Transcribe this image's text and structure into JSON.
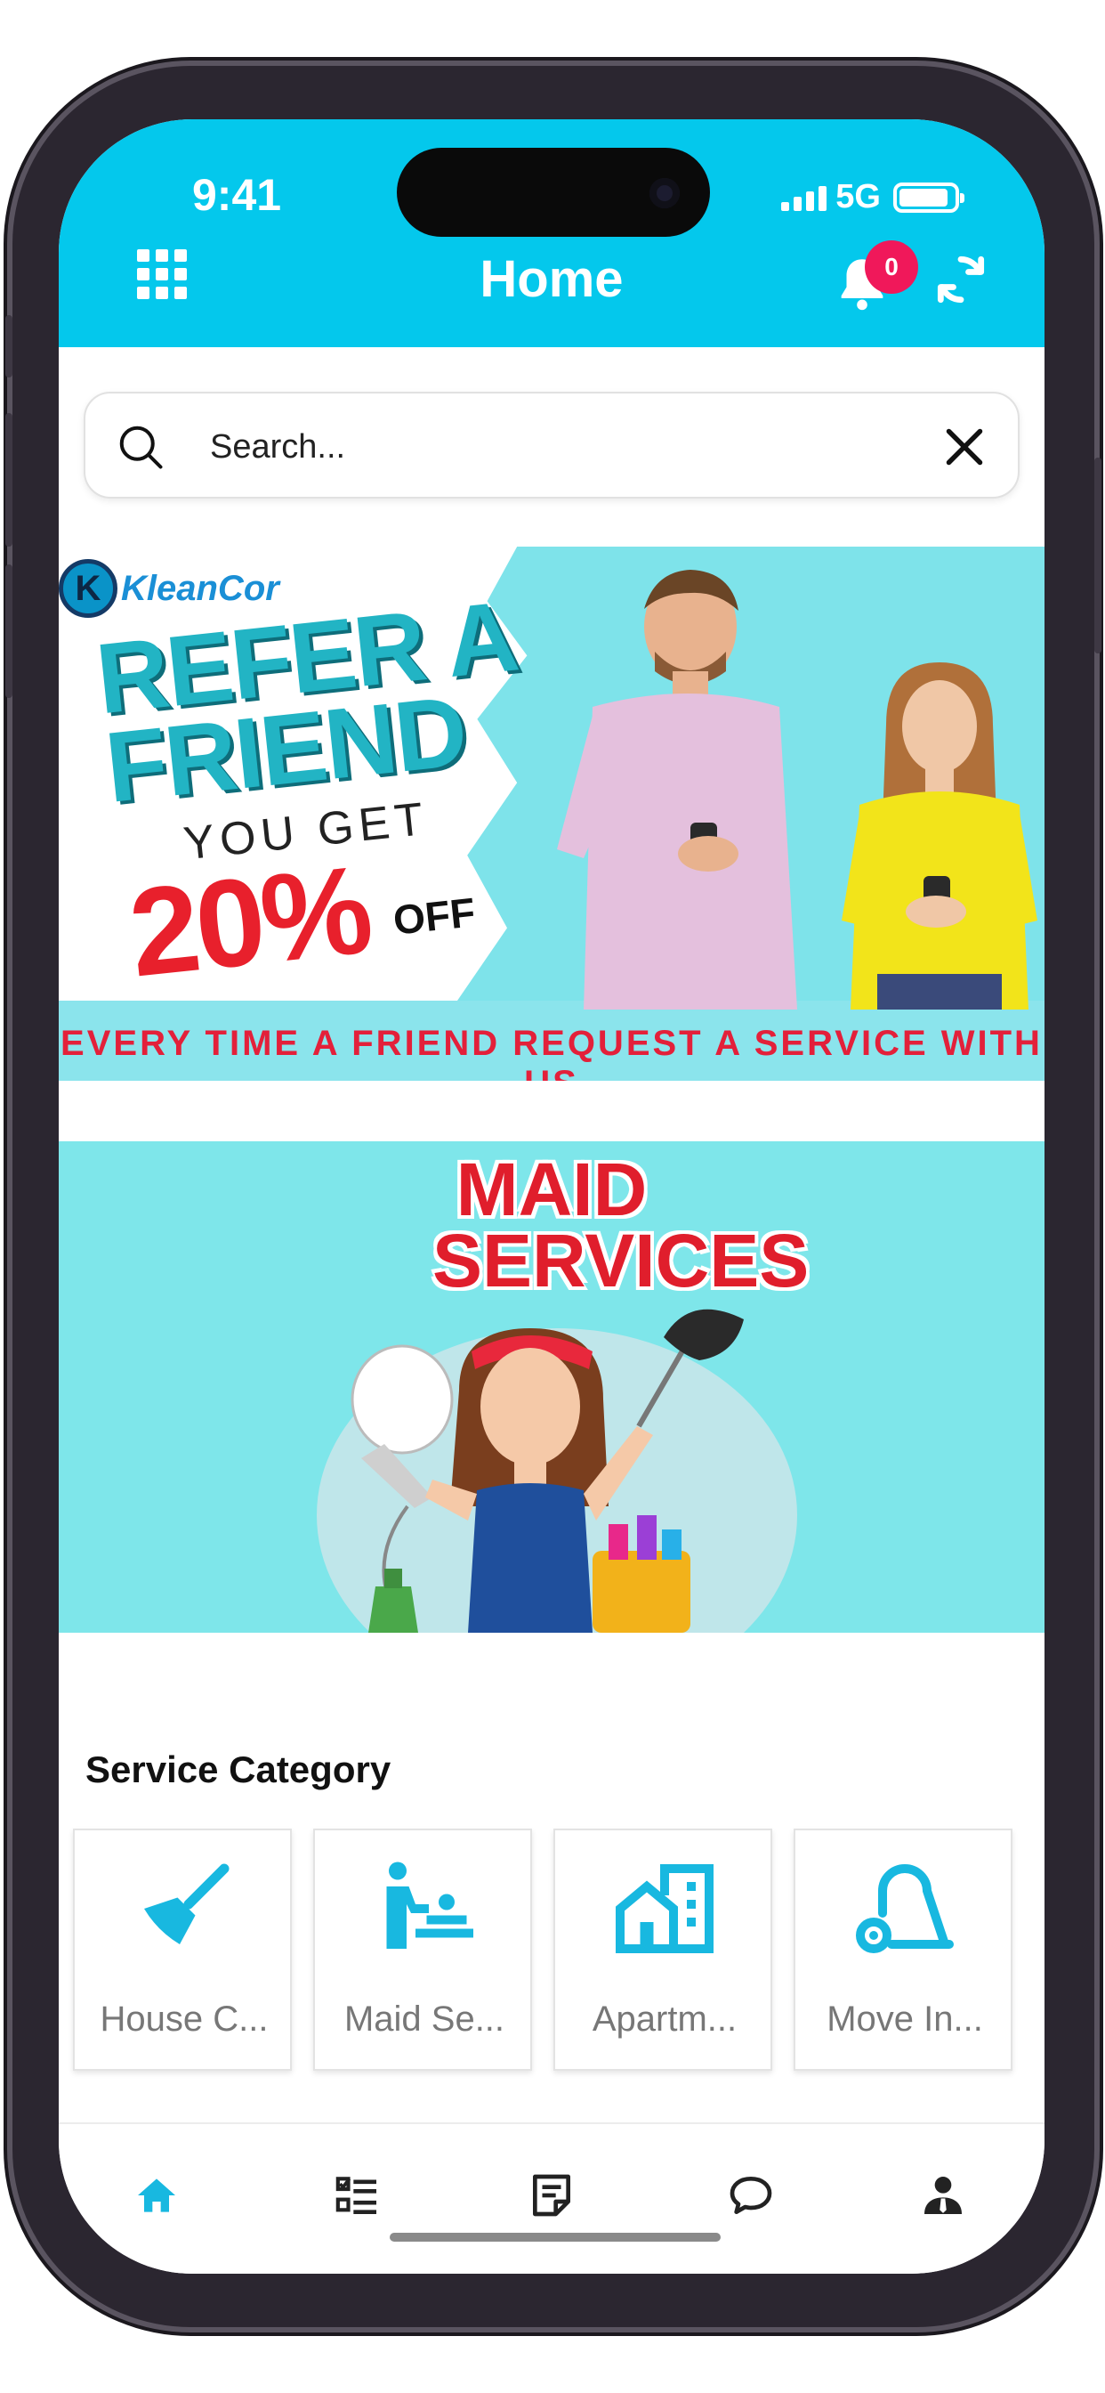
{
  "status_bar": {
    "time": "9:41",
    "network": "5G"
  },
  "header": {
    "title": "Home",
    "notification_count": "0"
  },
  "search": {
    "placeholder": "Search..."
  },
  "banners": {
    "refer": {
      "brand": "KleanCor",
      "logo_letter": "K",
      "headline": "REFER A FRIEND",
      "subline": "YOU GET",
      "discount": "20%",
      "off": "OFF",
      "footer": "EVERY TIME A FRIEND REQUEST A SERVICE WITH US"
    },
    "maid": {
      "title": "MAID SERVICES"
    }
  },
  "service_category": {
    "title": "Service Category",
    "items": [
      {
        "label": "House C...",
        "icon": "broom-icon"
      },
      {
        "label": "Maid Se...",
        "icon": "baby-changing-icon"
      },
      {
        "label": "Apartm...",
        "icon": "apartment-icon"
      },
      {
        "label": "Move In...",
        "icon": "vacuum-icon"
      }
    ]
  },
  "bottom_nav": [
    {
      "name": "home",
      "icon": "home-icon",
      "active": true
    },
    {
      "name": "tasks",
      "icon": "checklist-icon",
      "active": false
    },
    {
      "name": "notes",
      "icon": "note-icon",
      "active": false
    },
    {
      "name": "chat",
      "icon": "chat-icon",
      "active": false
    },
    {
      "name": "profile",
      "icon": "profile-icon",
      "active": false
    }
  ],
  "colors": {
    "primary": "#04c8ec",
    "badge": "#f0185a",
    "accent_red": "#e01e2c",
    "icon_blue": "#18b8e0"
  }
}
